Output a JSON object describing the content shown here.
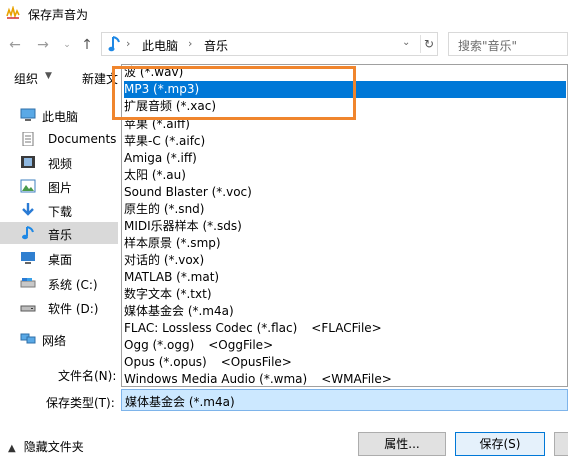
{
  "window": {
    "title": "保存声音为"
  },
  "nav": {
    "back_icon": "back-arrow-icon",
    "forward_icon": "forward-arrow-icon",
    "up_icon": "up-arrow-icon"
  },
  "address": {
    "crumbs": [
      "此电脑",
      "音乐"
    ]
  },
  "search": {
    "placeholder": "搜索\"音乐\""
  },
  "toolbar": {
    "organize": "组织",
    "new_folder": "新建文"
  },
  "sidebar": {
    "items": [
      {
        "label": "此电脑",
        "icon": "computer-icon",
        "top": true
      },
      {
        "label": "Documents",
        "icon": "documents-icon"
      },
      {
        "label": "视频",
        "icon": "video-icon"
      },
      {
        "label": "图片",
        "icon": "pictures-icon"
      },
      {
        "label": "下载",
        "icon": "download-icon"
      },
      {
        "label": "音乐",
        "icon": "music-icon",
        "selected": true
      },
      {
        "label": "桌面",
        "icon": "desktop-icon"
      },
      {
        "label": "系统 (C:)",
        "icon": "drive-icon"
      },
      {
        "label": "软件 (D:)",
        "icon": "drive-icon"
      },
      {
        "label": "网络",
        "icon": "network-icon",
        "top": true
      }
    ]
  },
  "dropdown": {
    "options": [
      {
        "label": "波 (*.wav)"
      },
      {
        "label": "MP3 (*.mp3)",
        "highlighted": true
      },
      {
        "label": "扩展音频 (*.xac)"
      },
      {
        "label": "苹果 (*.aiff)"
      },
      {
        "label": "苹果-C (*.aifc)"
      },
      {
        "label": "Amiga (*.iff)"
      },
      {
        "label": "太阳 (*.au)"
      },
      {
        "label": "Sound Blaster (*.voc)"
      },
      {
        "label": "原生的 (*.snd)"
      },
      {
        "label": "MIDI乐器样本 (*.sds)"
      },
      {
        "label": "样本原景 (*.smp)"
      },
      {
        "label": "对话的 (*.vox)"
      },
      {
        "label": "MATLAB (*.mat)"
      },
      {
        "label": "数字文本 (*.txt)"
      },
      {
        "label": "媒体基金会 (*.m4a)"
      },
      {
        "label": "FLAC: Lossless Codec (*.flac)",
        "ext": "<FLACFile>"
      },
      {
        "label": "Ogg (*.ogg)",
        "ext": "<OggFile>"
      },
      {
        "label": "Opus (*.opus)",
        "ext": "<OpusFile>"
      },
      {
        "label": "Windows Media Audio (*.wma)",
        "ext": "<WMAFile>"
      }
    ]
  },
  "form": {
    "filename_label": "文件名(N):",
    "filetype_label": "保存类型(T):",
    "filetype_value": "媒体基金会 (*.m4a)"
  },
  "footer": {
    "hide_folders": "隐藏文件夹",
    "properties_button": "属性...",
    "save_button": "保存(S)"
  },
  "colors": {
    "highlight": "#0078d7",
    "annotation": "#f0852d",
    "selected_bg": "#cce8ff"
  }
}
